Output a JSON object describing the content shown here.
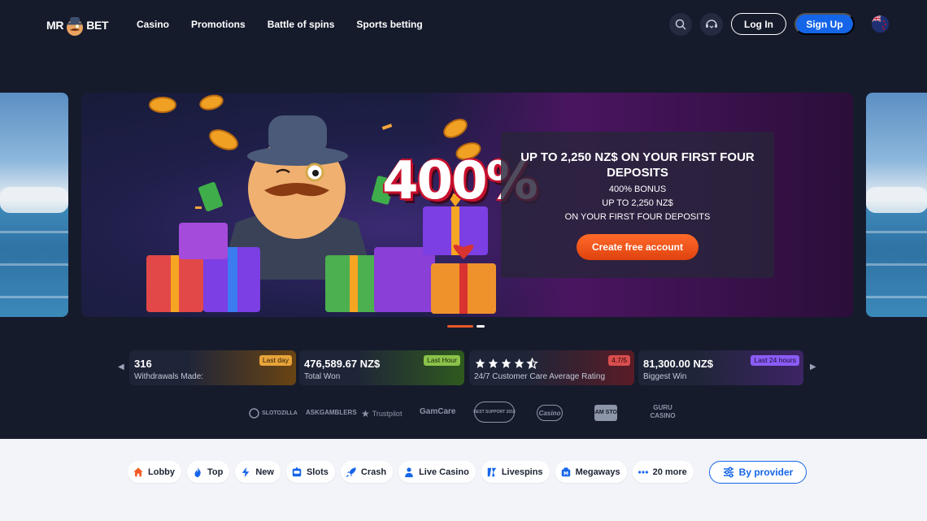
{
  "brand": {
    "logo_left": "MR",
    "logo_right": "BET"
  },
  "nav": [
    "Casino",
    "Promotions",
    "Battle of spins",
    "Sports betting"
  ],
  "header": {
    "login": "Log In",
    "signup": "Sign Up",
    "search_icon": "search-icon",
    "support_icon": "support-icon",
    "language_icon": "nz-flag-icon"
  },
  "hero": {
    "bonus_art_text": "400%",
    "title": "UP TO 2,250 NZ$ ON YOUR FIRST FOUR DEPOSITS",
    "lines": [
      "400% BONUS",
      "UP TO 2,250 NZ$",
      "ON YOUR FIRST FOUR DEPOSITS"
    ],
    "cta": "Create free account",
    "slides": 2,
    "active_slide": 1
  },
  "stats": [
    {
      "value": "316",
      "label": "Withdrawals Made:",
      "badge": "Last day",
      "color": "#e8a43a"
    },
    {
      "value": "476,589.67 NZ$",
      "label": "Total Won",
      "badge": "Last Hour",
      "color": "#8bc34a"
    },
    {
      "value": "",
      "label": "24/7 Customer Care Average Rating",
      "badge": "4.7/5",
      "color": "#d84e4e",
      "rating": 4.5
    },
    {
      "value": "81,300.00 NZ$",
      "label": "Biggest Win",
      "badge": "Last 24 hours",
      "color": "#8b5cf6"
    }
  ],
  "partners": [
    "SLOTOZILLA",
    "ASKGAMBLERS",
    "Trustpilot",
    "GamCare",
    "BEST SUPPORT 2018",
    "Casino",
    "GAM STOP",
    "GURU CASINO"
  ],
  "categories": [
    {
      "label": "Lobby",
      "icon": "home-icon",
      "color": "#f25a24"
    },
    {
      "label": "Top",
      "icon": "flame-icon",
      "color": "#1565e8"
    },
    {
      "label": "New",
      "icon": "lightning-icon",
      "color": "#1565e8"
    },
    {
      "label": "Slots",
      "icon": "slot-machine-icon",
      "color": "#1565e8"
    },
    {
      "label": "Crash",
      "icon": "rocket-icon",
      "color": "#1565e8"
    },
    {
      "label": "Live Casino",
      "icon": "person-icon",
      "color": "#1565e8"
    },
    {
      "label": "Livespins",
      "icon": "livespins-icon",
      "color": "#1565e8"
    },
    {
      "label": "Megaways",
      "icon": "megaways-icon",
      "color": "#1565e8"
    },
    {
      "label": "20 more",
      "icon": "more-dots-icon",
      "color": "#1565e8"
    }
  ],
  "provider_button": "By provider"
}
